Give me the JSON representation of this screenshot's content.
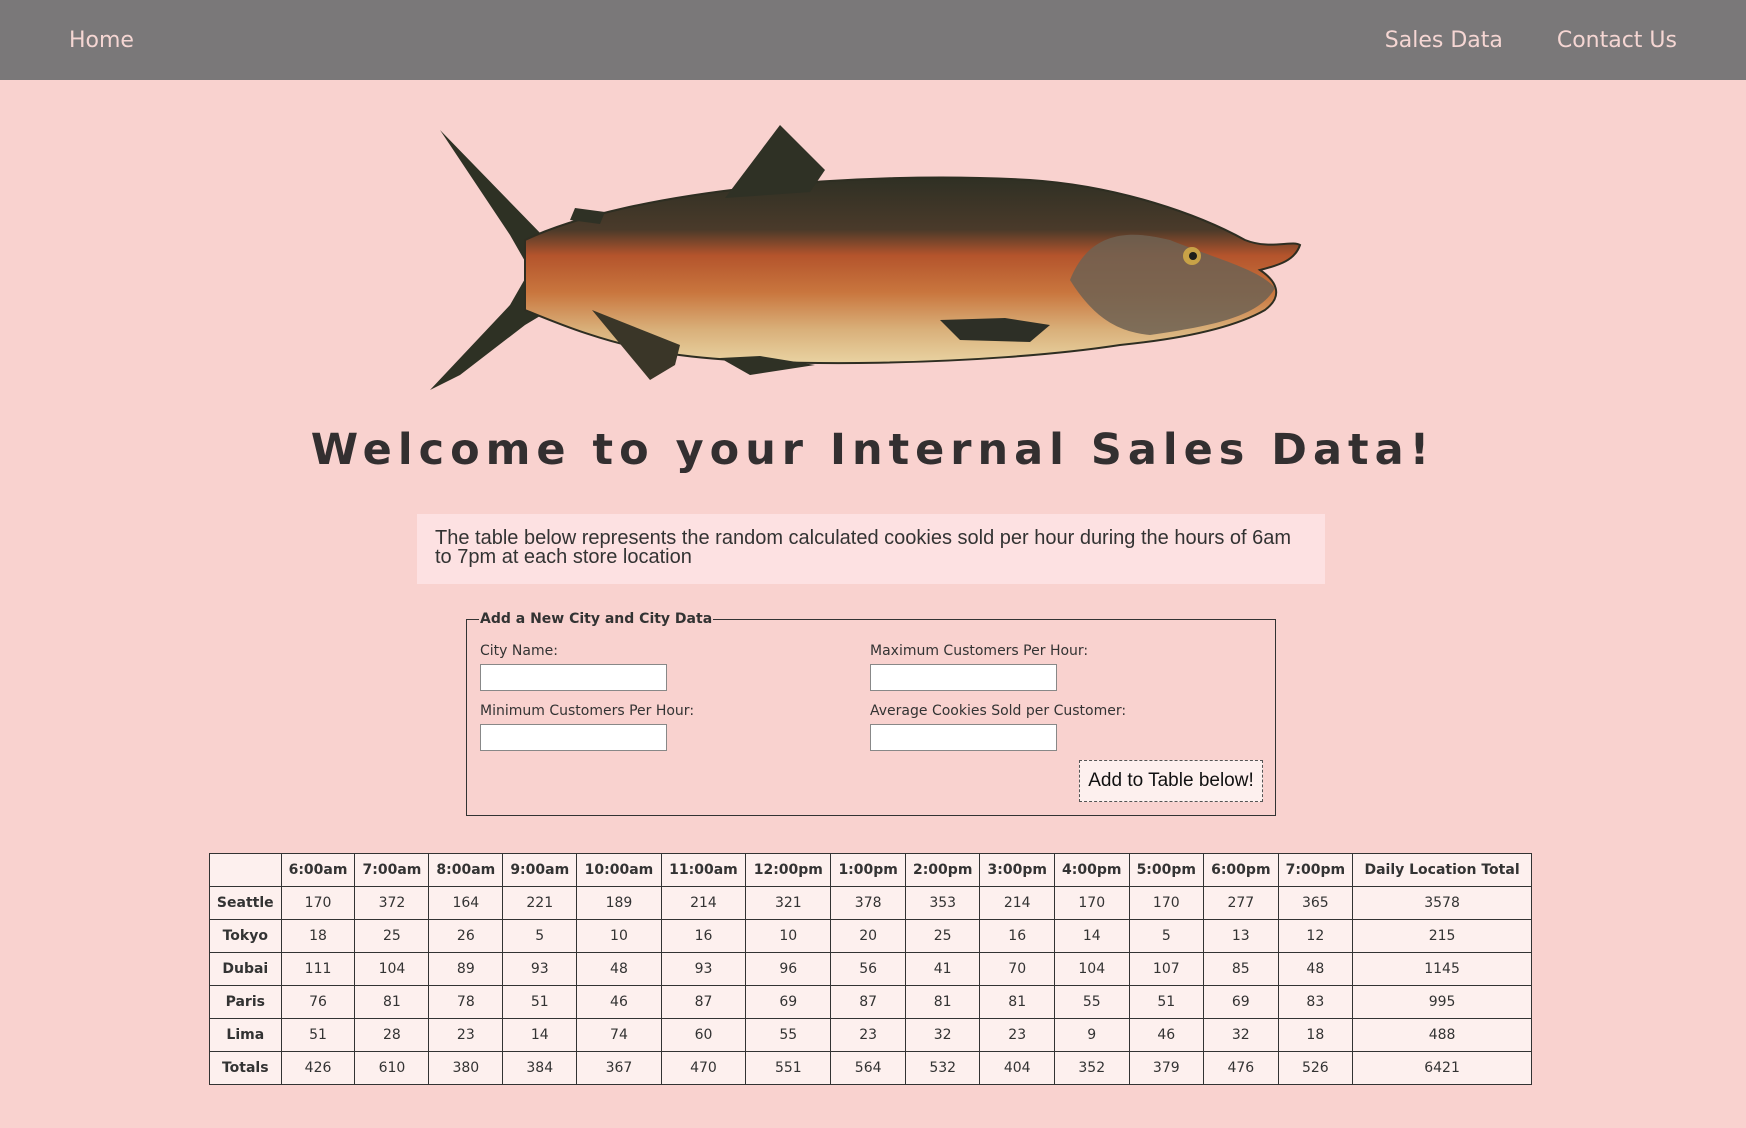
{
  "nav": {
    "home": "Home",
    "sales_data": "Sales Data",
    "contact_us": "Contact Us"
  },
  "hero": {
    "image": "salmon-fish-illustration"
  },
  "title": "Welcome to your Internal Sales Data!",
  "intro": "The table below represents the random calculated cookies sold per hour during the hours of 6am to 7pm at each store location",
  "form": {
    "legend": "Add a New City and City Data",
    "city_name_label": "City Name:",
    "max_customers_label": "Maximum Customers Per Hour:",
    "min_customers_label": "Minimum Customers Per Hour:",
    "avg_cookies_label": "Average Cookies Sold per Customer:",
    "city_name_value": "",
    "max_customers_value": "",
    "min_customers_value": "",
    "avg_cookies_value": "",
    "submit_label": "Add to Table below!"
  },
  "table": {
    "headers": [
      "",
      "6:00am",
      "7:00am",
      "8:00am",
      "9:00am",
      "10:00am",
      "11:00am",
      "12:00pm",
      "1:00pm",
      "2:00pm",
      "3:00pm",
      "4:00pm",
      "5:00pm",
      "6:00pm",
      "7:00pm",
      "Daily Location Total"
    ],
    "rows": [
      {
        "city": "Seattle",
        "values": [
          "170",
          "372",
          "164",
          "221",
          "189",
          "214",
          "321",
          "378",
          "353",
          "214",
          "170",
          "170",
          "277",
          "365",
          "3578"
        ]
      },
      {
        "city": "Tokyo",
        "values": [
          "18",
          "25",
          "26",
          "5",
          "10",
          "16",
          "10",
          "20",
          "25",
          "16",
          "14",
          "5",
          "13",
          "12",
          "215"
        ]
      },
      {
        "city": "Dubai",
        "values": [
          "111",
          "104",
          "89",
          "93",
          "48",
          "93",
          "96",
          "56",
          "41",
          "70",
          "104",
          "107",
          "85",
          "48",
          "1145"
        ]
      },
      {
        "city": "Paris",
        "values": [
          "76",
          "81",
          "78",
          "51",
          "46",
          "87",
          "69",
          "87",
          "81",
          "81",
          "55",
          "51",
          "69",
          "83",
          "995"
        ]
      },
      {
        "city": "Lima",
        "values": [
          "51",
          "28",
          "23",
          "14",
          "74",
          "60",
          "55",
          "23",
          "32",
          "23",
          "9",
          "46",
          "32",
          "18",
          "488"
        ]
      }
    ],
    "totals": {
      "label": "Totals",
      "values": [
        "426",
        "610",
        "380",
        "384",
        "367",
        "470",
        "551",
        "564",
        "532",
        "404",
        "352",
        "379",
        "476",
        "526",
        "6421"
      ]
    }
  },
  "colors": {
    "background": "#f9d2cf",
    "nav_bar": "#7a7879",
    "nav_link": "#f5d6d3",
    "intro_box": "#fde1e2",
    "table_bg": "#fdf0ee",
    "text": "#333333"
  }
}
